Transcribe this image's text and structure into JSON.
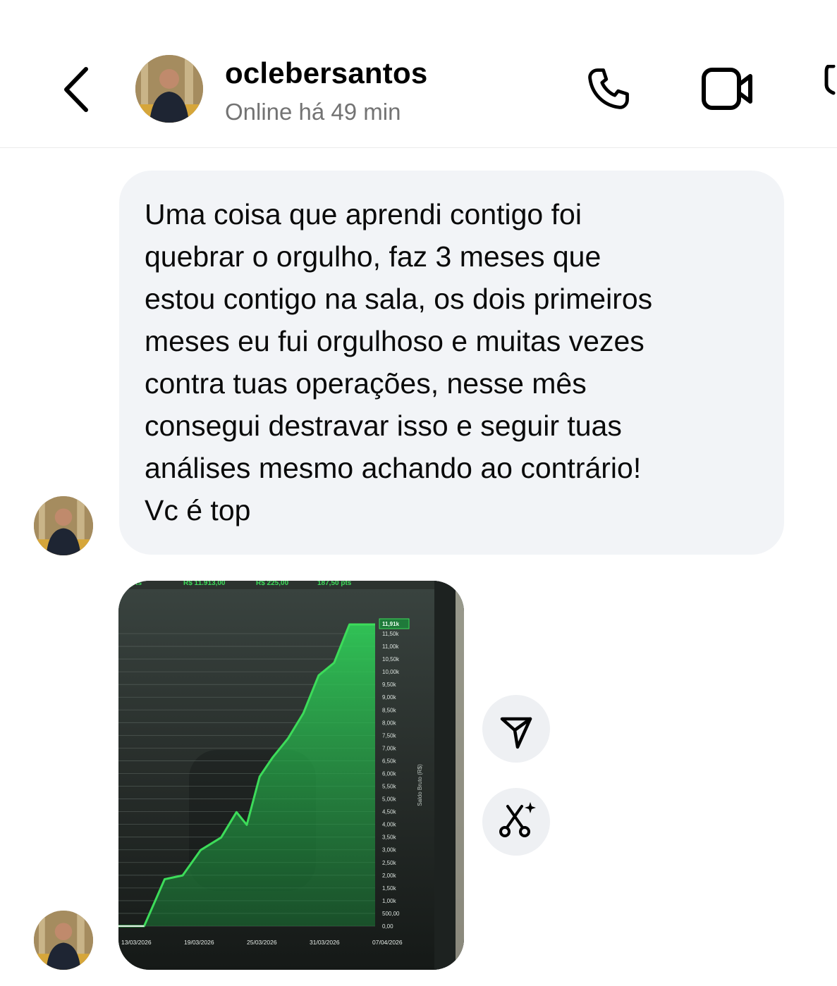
{
  "header": {
    "username": "oclebersantos",
    "status": "Online há 49 min",
    "icons": {
      "back": "chevron-left-icon",
      "call": "phone-icon",
      "video": "video-camera-icon"
    }
  },
  "message": {
    "text": "Uma coisa que aprendi contigo foi\nquebrar o orgulho, faz 3 meses que\nestou contigo na sala, os dois primeiros\nmeses eu fui orgulhoso e muitas vezes\ncontra tuas operações, nesse mês\nconsegui destravar isso e seguir tuas\nanálises mesmo achando ao contrário!\nVc é top"
  },
  "photo": {
    "top_values": [
      "pts",
      "R$ 11.913,00",
      "R$ 225,00",
      "187,50 pts"
    ],
    "last_value_label": "11,91k",
    "axis_title": "Saldo Bruto (R$)",
    "accent_color": "#3ddc5a",
    "chart_data": {
      "type": "area",
      "ylabel": "Saldo Bruto (R$)",
      "y_ticks": [
        "11,50k",
        "11,00k",
        "10,50k",
        "10,00k",
        "9,50k",
        "9,00k",
        "8,50k",
        "8,00k",
        "7,50k",
        "7,00k",
        "6,50k",
        "6,00k",
        "5,50k",
        "5,00k",
        "4,50k",
        "4,00k",
        "3,50k",
        "3,00k",
        "2,50k",
        "2,00k",
        "1,50k",
        "1,00k",
        "500,00",
        "0,00"
      ],
      "x_ticks": [
        "13/03/2026",
        "19/03/2026",
        "25/03/2026",
        "31/03/2026",
        "07/04/2026"
      ],
      "ylim": [
        0,
        11913
      ],
      "series": [
        {
          "x": [
            0,
            0.1,
            0.18,
            0.25,
            0.32,
            0.4,
            0.46,
            0.5,
            0.55,
            0.6,
            0.66,
            0.72,
            0.78,
            0.84,
            0.9,
            0.97,
            1.0
          ],
          "values": [
            0,
            0,
            1850,
            2000,
            3000,
            3500,
            4500,
            4000,
            5900,
            6650,
            7400,
            8400,
            9900,
            10400,
            11913,
            11913,
            11913
          ]
        }
      ]
    }
  },
  "actions": {
    "share_icon": "share-icon",
    "remix_icon": "sparkle-scissors-icon"
  }
}
